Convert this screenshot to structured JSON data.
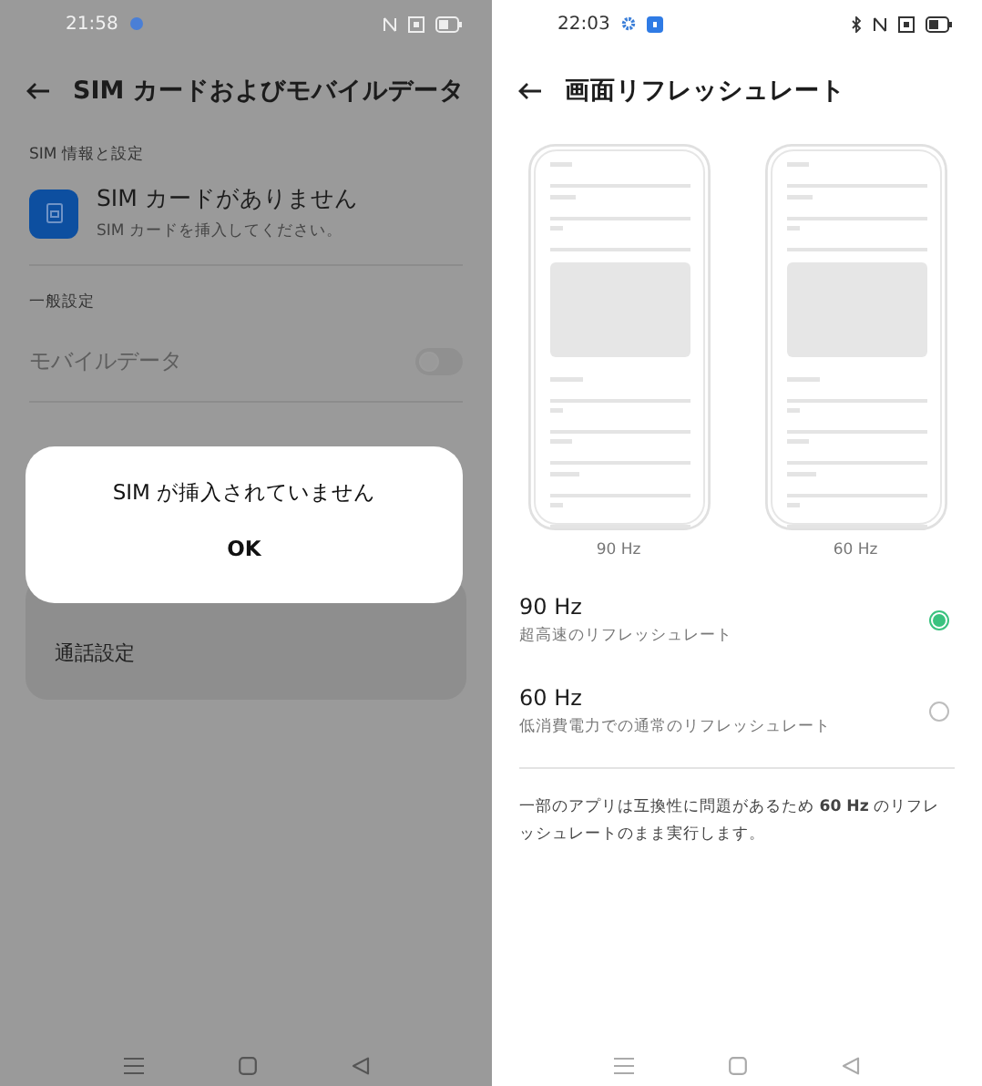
{
  "left_screen": {
    "status_bar": {
      "time": "21:58"
    },
    "header": {
      "title": "SIM カードおよびモバイルデータ"
    },
    "sim_section": {
      "label": "SIM 情報と設定",
      "title": "SIM カードがありません",
      "subtitle": "SIM カードを挿入してください。"
    },
    "general_section": {
      "label": "一般設定",
      "mobile_data": {
        "label": "モバイルデータ",
        "on": false,
        "disabled": true
      }
    },
    "card_item": "通話設定",
    "dialog": {
      "message": "SIM が挿入されていません",
      "button": "OK"
    }
  },
  "right_screen": {
    "status_bar": {
      "time": "22:03"
    },
    "header": {
      "title": "画面リフレッシュレート"
    },
    "previews": [
      {
        "label": "90 Hz"
      },
      {
        "label": "60 Hz"
      }
    ],
    "options": [
      {
        "title": "90 Hz",
        "subtitle": "超高速のリフレッシュレート",
        "selected": true
      },
      {
        "title": "60 Hz",
        "subtitle": "低消費電力での通常のリフレッシュレート",
        "selected": false
      }
    ],
    "note": "一部のアプリは互換性に問題があるため **60 Hz** のリフレッシュレートのまま実行します。"
  }
}
